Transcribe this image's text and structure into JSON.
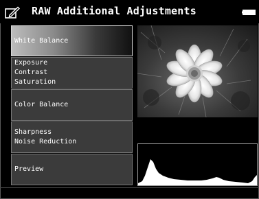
{
  "header": {
    "title": "RAW Additional Adjustments",
    "edit_icon": "edit-pencil-icon",
    "battery_icon": "battery-icon"
  },
  "menu": {
    "items": [
      {
        "lines": [
          "White Balance"
        ],
        "selected": true
      },
      {
        "lines": [
          "Exposure",
          "Contrast",
          "Saturation"
        ],
        "selected": false
      },
      {
        "lines": [
          "Color Balance"
        ],
        "selected": false
      },
      {
        "lines": [
          "Sharpness",
          "Noise Reduction"
        ],
        "selected": false
      },
      {
        "lines": [
          "Preview"
        ],
        "selected": false
      }
    ]
  },
  "preview": {
    "image": "flower-photo"
  },
  "histogram": {
    "icon": "histogram"
  },
  "colors": {
    "background": "#000000",
    "item_bg": "#3b3b3b",
    "item_border": "#7a7a7a",
    "text": "#ffffff"
  }
}
